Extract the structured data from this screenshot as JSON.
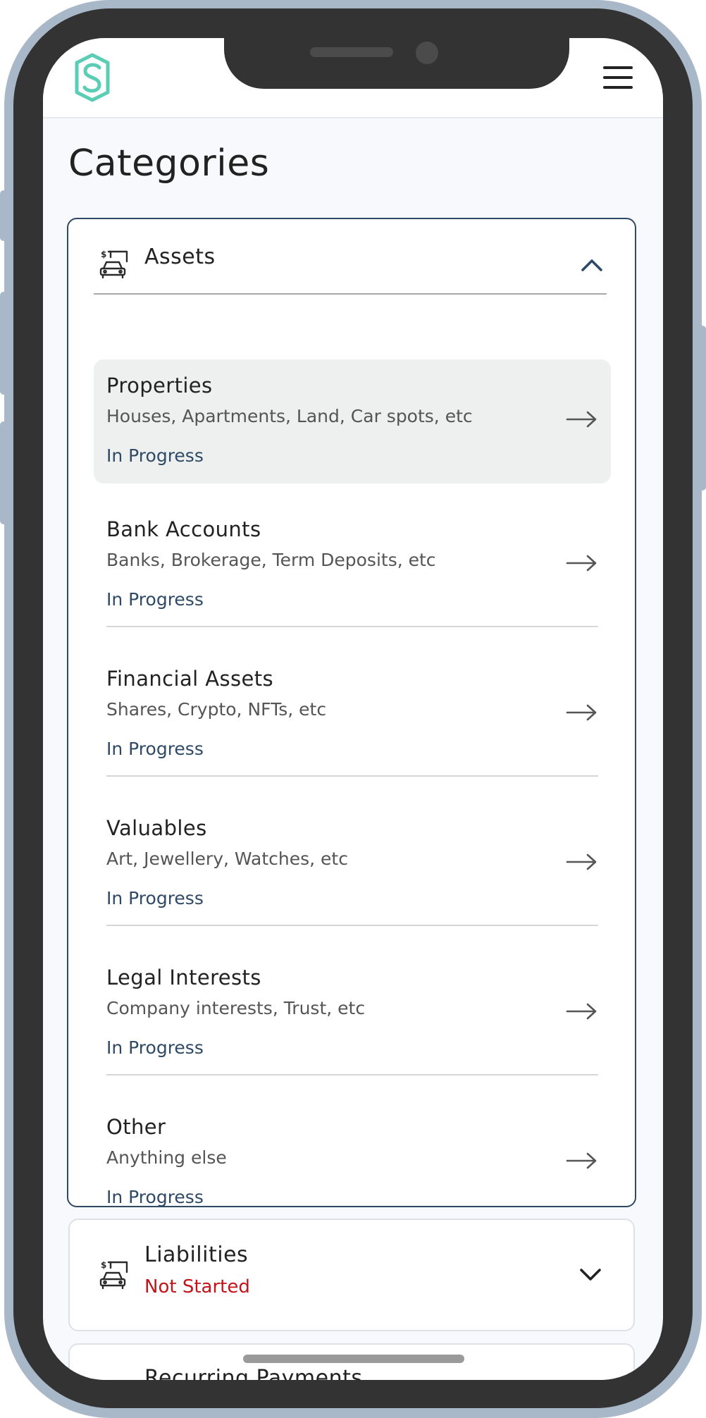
{
  "colors": {
    "frame": "#a9b8c9",
    "bezel": "#333333",
    "brand": "#5bcdb4",
    "accent_navy": "#2f4a66",
    "status_not_started": "#c4141a"
  },
  "header": {
    "logo_icon": "brand-s-logo",
    "menu_icon": "hamburger-menu-icon"
  },
  "page": {
    "title": "Categories"
  },
  "assets": {
    "title": "Assets",
    "icon": "car-money-icon",
    "expanded": true,
    "items": [
      {
        "title": "Properties",
        "desc": "Houses, Apartments, Land, Car spots, etc",
        "status": "In Progress"
      },
      {
        "title": "Bank Accounts",
        "desc": "Banks, Brokerage, Term Deposits, etc",
        "status": "In Progress"
      },
      {
        "title": "Financial Assets",
        "desc": "Shares, Crypto, NFTs, etc",
        "status": "In Progress"
      },
      {
        "title": "Valuables",
        "desc": "Art, Jewellery, Watches, etc",
        "status": "In Progress"
      },
      {
        "title": "Legal Interests",
        "desc": "Company interests, Trust, etc",
        "status": "In Progress"
      },
      {
        "title": "Other",
        "desc": "Anything else",
        "status": "In Progress"
      }
    ]
  },
  "liabilities": {
    "title": "Liabilities",
    "status": "Not Started",
    "icon": "car-money-icon",
    "expanded": false
  },
  "recurring": {
    "title": "Recurring Payments"
  }
}
